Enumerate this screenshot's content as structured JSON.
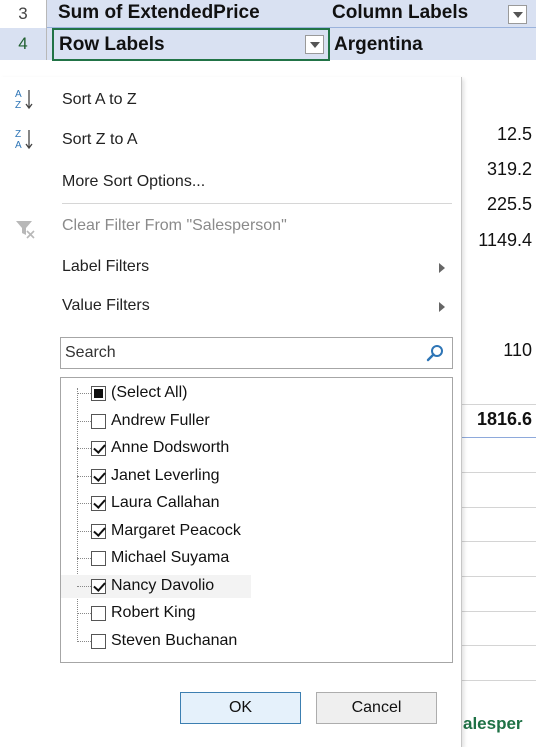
{
  "sheet": {
    "row3_num": "3",
    "row4_num": "4",
    "a3": "Sum of ExtendedPrice",
    "b3": "Column Labels",
    "a4": "Row Labels",
    "b4": "Argentina",
    "values": [
      "12.5",
      "319.2",
      "225.5",
      "1149.4",
      "110",
      "1816.6"
    ],
    "bottom_text": "alesper"
  },
  "menu": {
    "sort_az": "Sort A to Z",
    "sort_za": "Sort Z to A",
    "more_sort": "More Sort Options...",
    "clear_filter": "Clear Filter From \"Salesperson\"",
    "label_filters": "Label Filters",
    "value_filters": "Value Filters",
    "search_placeholder": "Search",
    "items": [
      {
        "label": "(Select All)",
        "state": "partial"
      },
      {
        "label": "Andrew Fuller",
        "state": "unchecked"
      },
      {
        "label": "Anne Dodsworth",
        "state": "checked"
      },
      {
        "label": "Janet Leverling",
        "state": "checked"
      },
      {
        "label": "Laura Callahan",
        "state": "checked"
      },
      {
        "label": "Margaret Peacock",
        "state": "checked"
      },
      {
        "label": "Michael Suyama",
        "state": "unchecked"
      },
      {
        "label": "Nancy Davolio",
        "state": "checked"
      },
      {
        "label": "Robert King",
        "state": "unchecked"
      },
      {
        "label": "Steven Buchanan",
        "state": "unchecked"
      }
    ],
    "ok_label": "OK",
    "cancel_label": "Cancel"
  },
  "colors": {
    "header_band": "#d9e1f2",
    "selection_border": "#217346",
    "ok_border": "#3c7fb1"
  }
}
